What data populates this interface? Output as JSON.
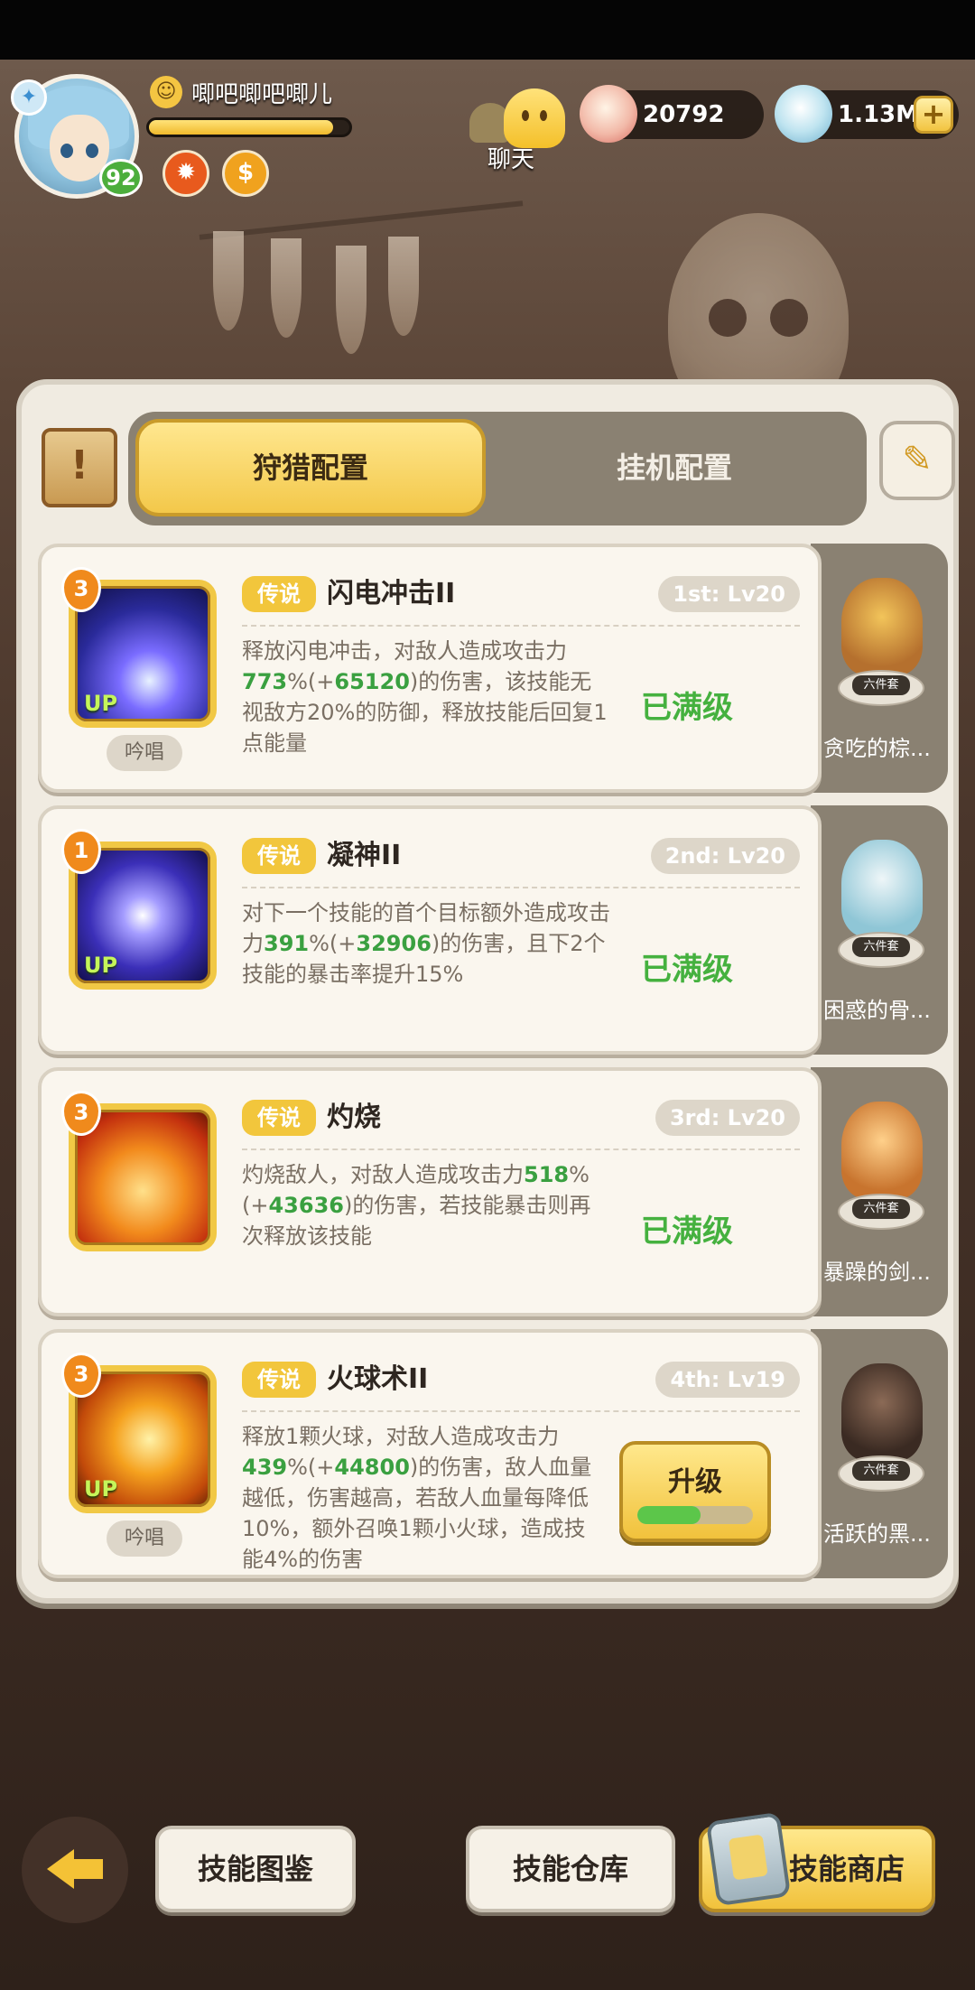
{
  "player": {
    "name": "唧吧唧吧唧儿",
    "level": "92",
    "exp_progress": 0.92
  },
  "hud": {
    "chat_label": "聊天",
    "currency_shells": "20792",
    "currency_gems": "1.13M",
    "plus": "+"
  },
  "tabs": {
    "hunt": "狩猎配置",
    "idle": "挂机配置"
  },
  "skills": [
    {
      "count": "3",
      "rarity": "传说",
      "name": "闪电冲击II",
      "slot": "1st: Lv20",
      "chant": "吟唱",
      "has_up": true,
      "desc_pre": "释放闪电冲击，对敌人造成攻击力",
      "hl1": "773",
      "desc_mid1": "%(+",
      "hl2": "65120",
      "desc_post": ")的伤害，该技能无视敌方20%的防御，释放技能后回复1点能量",
      "status": "已满级",
      "pet_name": "贪吃的棕..."
    },
    {
      "count": "1",
      "rarity": "传说",
      "name": "凝神II",
      "slot": "2nd: Lv20",
      "chant": "",
      "has_up": true,
      "desc_pre": "对下一个技能的首个目标额外造成攻击力",
      "hl1": "391",
      "desc_mid1": "%(+",
      "hl2": "32906",
      "desc_post": ")的伤害，且下2个技能的暴击率提升15%",
      "status": "已满级",
      "pet_name": "困惑的骨..."
    },
    {
      "count": "3",
      "rarity": "传说",
      "name": "灼烧",
      "slot": "3rd: Lv20",
      "chant": "",
      "has_up": false,
      "desc_pre": "灼烧敌人，对敌人造成攻击力",
      "hl1": "518",
      "desc_mid1": "%(+",
      "hl2": "43636",
      "desc_post": ")的伤害，若技能暴击则再次释放该技能",
      "status": "已满级",
      "pet_name": "暴躁的剑..."
    },
    {
      "count": "3",
      "rarity": "传说",
      "name": "火球术II",
      "slot": "4th: Lv19",
      "chant": "吟唱",
      "has_up": true,
      "desc_pre": "释放1颗火球，对敌人造成攻击力",
      "hl1": "439",
      "desc_mid1": "%(+",
      "hl2": "44800",
      "desc_post": ")的伤害，敌人血量越低，伤害越高，若敌人血量每降低10%，额外召唤1颗小火球，造成技能4%的伤害",
      "upgrade_label": "升级",
      "upgrade_progress": 0.55,
      "pet_name": "活跃的黑..."
    }
  ],
  "pet_tag": "六件套",
  "skill_up_label": "UP",
  "bottom": {
    "codex": "技能图鉴",
    "storage": "技能仓库",
    "shop": "技能商店"
  },
  "colors": {
    "accent_gold": "#f2c63c",
    "highlight_green": "#3aa040",
    "panel_bg": "#f0ebe1"
  }
}
